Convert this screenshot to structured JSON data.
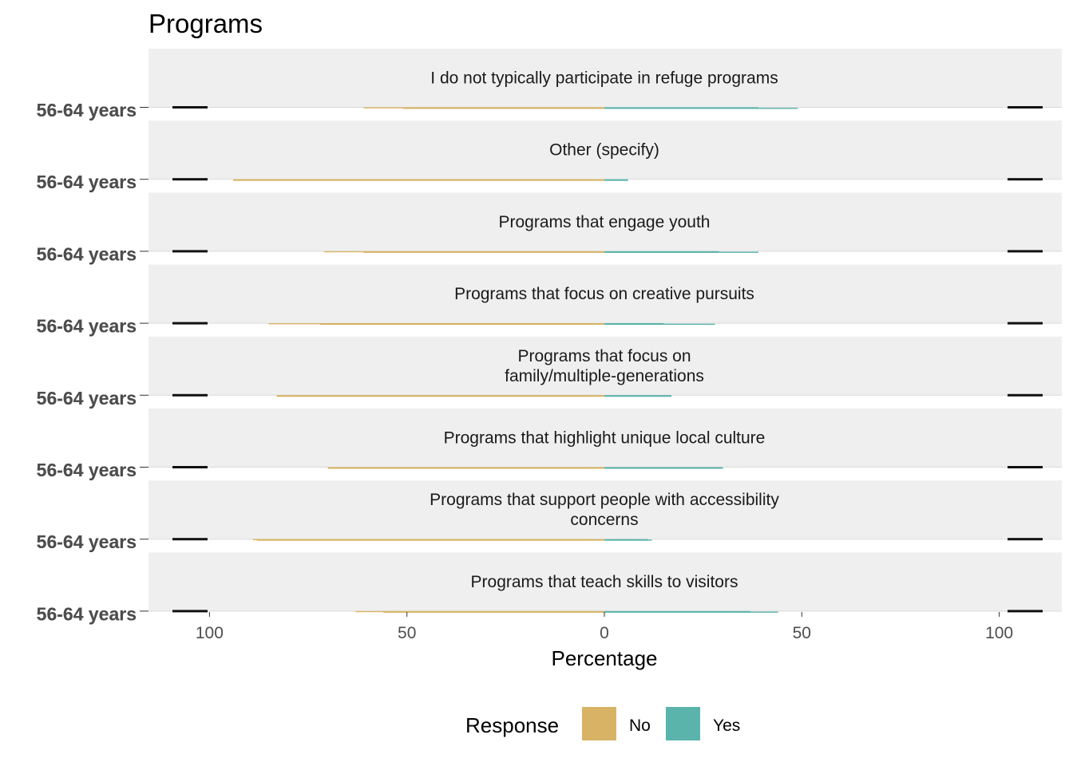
{
  "chart_data": {
    "type": "bar",
    "orientation": "horizontal-diverging",
    "title": "Programs",
    "xlabel": "Percentage",
    "xlim": [
      -115,
      115
    ],
    "x_ticks": [
      -100,
      -50,
      0,
      50,
      100
    ],
    "x_tick_labels": [
      "100",
      "50",
      "0",
      "50",
      "100"
    ],
    "y_tick_label": "56-64 years",
    "grid": false,
    "legend": {
      "title": "Response",
      "placement": "bottom",
      "entries": [
        {
          "name": "No",
          "color": "#D8B365"
        },
        {
          "name": "Yes",
          "color": "#5AB4AC"
        }
      ]
    },
    "panels": [
      {
        "label": "I do not typically participate in refuge programs",
        "no_values": [
          61,
          51
        ],
        "yes_values": [
          39,
          49
        ]
      },
      {
        "label": "Other (specify)",
        "no_values": [
          94,
          94
        ],
        "yes_values": [
          6,
          6
        ]
      },
      {
        "label": "Programs that engage youth",
        "no_values": [
          71,
          61
        ],
        "yes_values": [
          29,
          39
        ]
      },
      {
        "label": "Programs that focus on creative pursuits",
        "no_values": [
          85,
          72
        ],
        "yes_values": [
          15,
          28
        ]
      },
      {
        "label": "Programs that focus on\nfamily/multiple-generations",
        "no_values": [
          83,
          83
        ],
        "yes_values": [
          17,
          17
        ]
      },
      {
        "label": "Programs that highlight unique local culture",
        "no_values": [
          70,
          70
        ],
        "yes_values": [
          30,
          30
        ]
      },
      {
        "label": "Programs that support people with accessibility\nconcerns",
        "no_values": [
          89,
          88
        ],
        "yes_values": [
          11,
          12
        ]
      },
      {
        "label": "Programs that teach skills to visitors",
        "no_values": [
          63,
          56
        ],
        "yes_values": [
          37,
          44
        ]
      }
    ]
  }
}
